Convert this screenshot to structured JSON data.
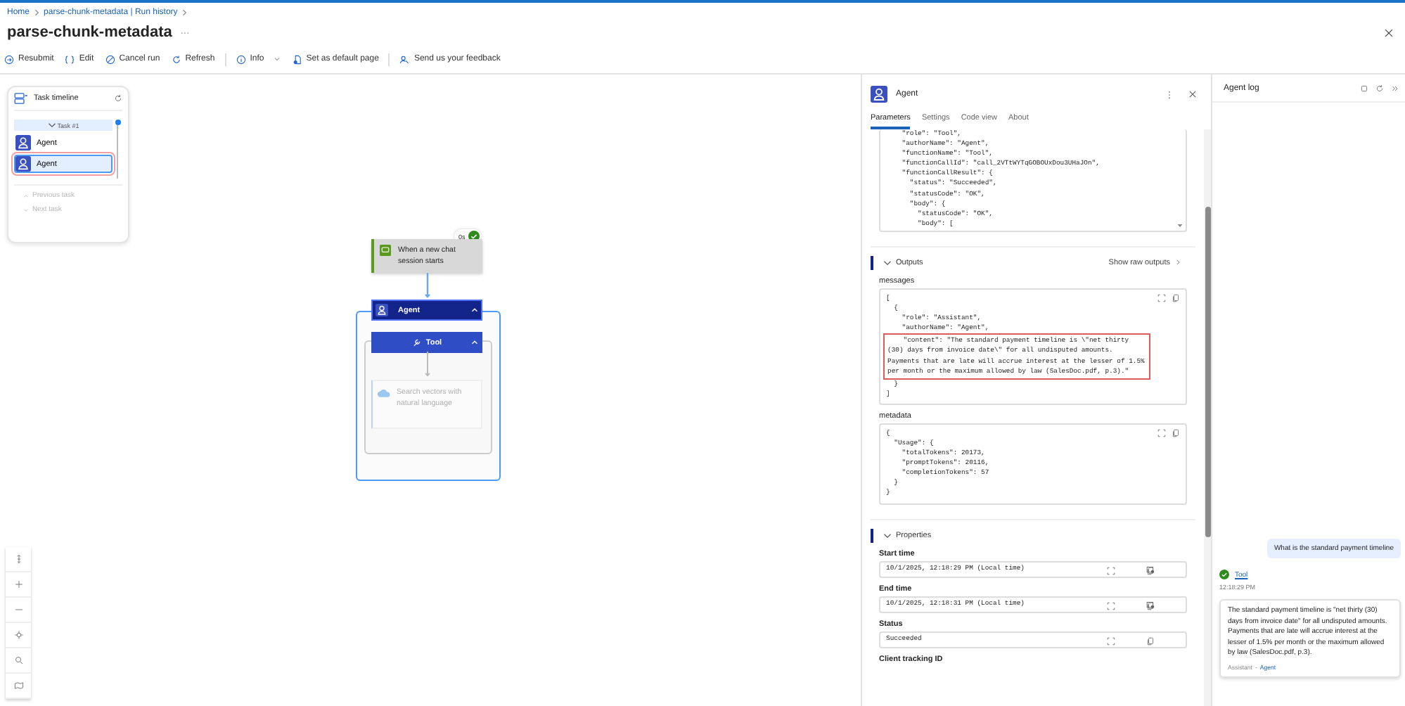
{
  "breadcrumb": [
    "Home",
    "parse-chunk-metadata | Run history"
  ],
  "title": "parse-chunk-metadata",
  "toolbar": [
    {
      "kind": "resubmit",
      "label": "Resubmit"
    },
    {
      "kind": "edit",
      "label": "Edit"
    },
    {
      "kind": "cancel",
      "label": "Cancel run"
    },
    {
      "kind": "refresh",
      "label": "Refresh"
    },
    {
      "kind": "separator"
    },
    {
      "kind": "info",
      "label": "Info"
    },
    {
      "kind": "default",
      "label": "Set as default page"
    },
    {
      "kind": "separator"
    },
    {
      "kind": "feedback",
      "label": "Send us your feedback"
    }
  ],
  "task_timeline": {
    "title": "Task timeline",
    "group": {
      "label": "Task #1",
      "expanded": true
    },
    "items": [
      {
        "label": "Agent",
        "selected": false
      },
      {
        "label": "Agent",
        "selected": true
      }
    ],
    "nav": [
      {
        "label": "Previous task",
        "disabled": true
      },
      {
        "label": "Next task",
        "disabled": true
      }
    ]
  },
  "flow": {
    "trigger": {
      "label": "When a new chat session starts",
      "duration": "0s",
      "succeeded": true
    },
    "agent": {
      "label": "Agent",
      "expanded": true
    },
    "tool": {
      "label": "Tool",
      "expanded": true
    },
    "action": {
      "label": "Search vectors with natural language",
      "disabled": true
    }
  },
  "details": {
    "title": "Agent",
    "tabs": [
      {
        "label": "Parameters",
        "selected": true
      },
      {
        "label": "Settings",
        "selected": false
      },
      {
        "label": "Code view",
        "selected": false
      },
      {
        "label": "About",
        "selected": false
      }
    ],
    "parameters_code": [
      "    \"role\": \"Tool\",",
      "    \"authorName\": \"Agent\",",
      "    \"functionName\": \"Tool\",",
      "    \"functionCallId\": \"call_2VTtWYTqGOBOUxDou3UHaJOn\",",
      "    \"functionCallResult\": {",
      "      \"status\": \"Succeeded\",",
      "      \"statusCode\": \"OK\",",
      "      \"body\": {",
      "        \"statusCode\": \"OK\",",
      "        \"body\": ["
    ],
    "outputs": {
      "title": "Outputs",
      "expanded": true,
      "action": "Show raw outputs",
      "fields": [
        {
          "label": "messages",
          "lines": [
            {
              "text": "[",
              "highlighted": false
            },
            {
              "text": "  {",
              "highlighted": false
            },
            {
              "text": "    \"role\": \"Assistant\",",
              "highlighted": false
            },
            {
              "text": "    \"authorName\": \"Agent\",",
              "highlighted": false
            },
            {
              "text": "    \"content\": \"The standard payment timeline is \\\"net thirty",
              "highlighted": true
            },
            {
              "text": "(30) days from invoice date\\\" for all undisputed amounts.",
              "highlighted": true
            },
            {
              "text": "Payments that are late will accrue interest at the lesser of 1.5%",
              "highlighted": true
            },
            {
              "text": "per month or the maximum allowed by law (SalesDoc.pdf, p.3).\"",
              "highlighted": true
            },
            {
              "text": "  }",
              "highlighted": false
            },
            {
              "text": "]",
              "highlighted": false
            }
          ]
        },
        {
          "label": "metadata",
          "lines": [
            {
              "text": "{",
              "highlighted": false
            },
            {
              "text": "  \"Usage\": {",
              "highlighted": false
            },
            {
              "text": "    \"totalTokens\": 20173,",
              "highlighted": false
            },
            {
              "text": "    \"promptTokens\": 20116,",
              "highlighted": false
            },
            {
              "text": "    \"completionTokens\": 57",
              "highlighted": false
            },
            {
              "text": "  }",
              "highlighted": false
            },
            {
              "text": "}",
              "highlighted": false
            }
          ]
        }
      ]
    },
    "properties": {
      "title": "Properties",
      "expanded": true,
      "fields": [
        {
          "label": "Start time",
          "value": "10/1/2025, 12:18:29 PM (Local time)",
          "calendar": true
        },
        {
          "label": "End time",
          "value": "10/1/2025, 12:18:31 PM (Local time)",
          "calendar": true
        },
        {
          "label": "Status",
          "value": "Succeeded",
          "calendar": false
        }
      ],
      "next_label": "Client tracking ID"
    }
  },
  "agent_log": {
    "title": "Agent log",
    "messages": [
      {
        "kind": "user",
        "text": "What is the standard payment timeline"
      },
      {
        "kind": "tool",
        "label": "Tool",
        "time": "12:18:29 PM"
      },
      {
        "kind": "assistant",
        "text": "The standard payment timeline is \"net thirty (30) days from invoice date\" for all undisputed amounts. Payments that are late will accrue interest at the lesser of 1.5% per month or the maximum allowed by law (SalesDoc.pdf, p.3).",
        "role": "Assistant",
        "separator": "-",
        "agent": "Agent"
      }
    ]
  }
}
